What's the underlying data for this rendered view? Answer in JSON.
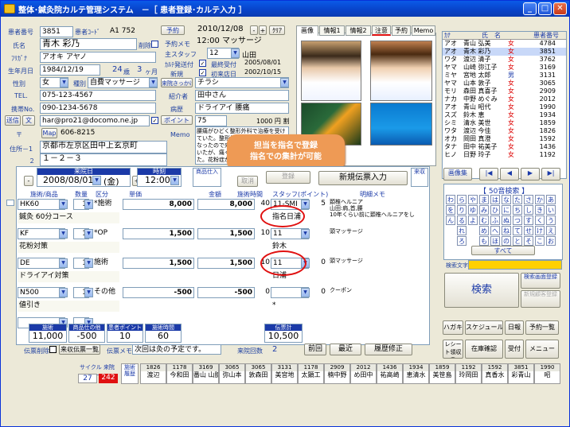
{
  "window": {
    "title": "整体･鍼灸院カルテ管理システム　－［ 患者登録･カルテ入力 ］"
  },
  "patient": {
    "no_label": "患者番号",
    "no": "3851",
    "code_label": "患者ｺｰﾄﾞ",
    "code": "A1 752",
    "name_label": "氏名",
    "name": "青木 彩乃",
    "delete_label": "削除",
    "furigana_label": "ﾌﾘｶﾞﾅ",
    "furigana": "アオキ アヤノ",
    "birth_label": "生年月日",
    "birth": "1984/12/19",
    "age": "24",
    "age_unit": "歳",
    "months": "3",
    "months_unit": "ヶ月",
    "sex_label": "性別",
    "sex": "女",
    "type_label": "種別",
    "type": "自費マッサージ",
    "tel_label": "TEL.",
    "tel": "075-123-4567",
    "mobile_label": "携帯No.",
    "mobile": "090-1234-5678",
    "email_btn": "送信",
    "email_btn2": "文",
    "email": "har@pro21@docomo.ne.jp",
    "zip_label": "〒",
    "map_btn": "Map",
    "zip": "606-8215",
    "addr1_label": "住所－1",
    "addr1": "京都市左京区田中上玄京町",
    "addr2_label": "２",
    "addr2": "１－２－３"
  },
  "reserve": {
    "label": "予約",
    "date": "2010/12/08",
    "minus": "-",
    "plus": "+",
    "clear": "ｸﾘｱ",
    "memo_label": "予約メモ",
    "memo": "12:00 マッサージ",
    "staff_label": "主スタッフ",
    "staff_no": "12",
    "staff_name": "山田",
    "last_label": "ｶﾙﾃ発送付",
    "last_check": "最終受付",
    "last_date": "2005/08/01",
    "new_label": "新規",
    "first_check": "初来店日",
    "first_date": "2002/10/15",
    "source_btn": "来院きっかけ",
    "source": "チラシ",
    "intro_label": "紹介者",
    "intro": "田中さん",
    "disease_label": "病歴",
    "disease": "ドライアイ 腰痛",
    "point_btn": "ポイント",
    "point": "75",
    "point_extra": "1000 円 割",
    "memo2_label": "Memo",
    "memo2": "腰痛がひどく整形外科で治療を受けていた。整形外科での治療より楽になったので来院された。牽引もしていたが、痛くなって嫌がってやめた。花粉症がひどいので、毎年春は大変。"
  },
  "tabs": {
    "items": [
      "画像",
      "情報1",
      "情報2",
      "注意",
      "予約",
      "Memo"
    ]
  },
  "tooltip": {
    "line1": "担当を指名で登録",
    "line2": "指名での集計が可能"
  },
  "visit": {
    "date_label": "来院日",
    "date": "2008/08/01",
    "weekday": "(金)",
    "minus": "-",
    "plus": "+",
    "time_label": "時刻",
    "time": "12:00",
    "product_label": "商品仕入",
    "cancel": "取消",
    "register": "登録",
    "new_slip": "新規伝票入力",
    "receipt_label": "来収"
  },
  "table": {
    "headers": [
      "施術/商品",
      "数量",
      "区分",
      "単価",
      "金額",
      "施術時間",
      "スタッフ(ポイント)",
      "明細メモ"
    ],
    "rows": [
      {
        "code": "HK60",
        "qty": "1",
        "cat": "*施術",
        "price": "8,000",
        "amount": "8,000",
        "time": "40",
        "staff": "11-SMI",
        "pts": "5",
        "memo": "頚椎ヘルニア\n山田:肩,首,腰\n10年くらい前に頚椎ヘルニアをし",
        "sub": "鍼灸 60分コース",
        "staff_sub": "指名日浦"
      },
      {
        "code": "KF",
        "qty": "1",
        "cat": "*OP",
        "price": "1,500",
        "amount": "1,500",
        "time": "10",
        "staff": "11",
        "pts": "",
        "memo": "頭マッサージ",
        "sub": "花粉対策",
        "staff_sub": "鈴木"
      },
      {
        "code": "DE",
        "qty": "1",
        "cat": "施術",
        "price": "1,500",
        "amount": "1,500",
        "time": "10",
        "staff": "11",
        "pts": "0",
        "memo": "頭マッサージ",
        "sub": "ドライアイ対策",
        "staff_sub": "日浦"
      },
      {
        "code": "N500",
        "qty": "1",
        "cat": "その他",
        "price": "-500",
        "amount": "-500",
        "time": "0",
        "staff": "",
        "pts": "0",
        "memo": "クーポン",
        "sub": "値引き",
        "staff_sub": "*"
      }
    ]
  },
  "totals": {
    "treat_label": "施術",
    "treat": "11,000",
    "goods_label": "商品仕の他",
    "goods": "-500",
    "point_label": "患者ポイント",
    "point": "10",
    "time_label": "施術時間",
    "time": "60",
    "slip_label": "伝票計",
    "slip": "10,500",
    "slip_delete": "伝票削除",
    "list_btn": "来収伝票一覧",
    "memo_label": "伝票メモ",
    "memo": "次回は灸の予定です。",
    "visits_label": "来院回数",
    "visits": "2",
    "prev": "前回",
    "latest": "最近",
    "history": "履歴修正"
  },
  "namelist": {
    "headers": [
      "ｶﾅ",
      "氏　名",
      "患者番号"
    ],
    "rows": [
      [
        "アオ",
        "青山 弘美",
        "女",
        "4784"
      ],
      [
        "アオ",
        "青木 彩乃",
        "女",
        "3851"
      ],
      [
        "ワタ",
        "渡辺 清子",
        "女",
        "3762"
      ],
      [
        "ヤマ",
        "山崎 弥江子",
        "女",
        "3169"
      ],
      [
        "ミヤ",
        "宮地 太郎",
        "男",
        "3131"
      ],
      [
        "ヤマ",
        "山本 敦子",
        "女",
        "3065"
      ],
      [
        "モリ",
        "森田 真喜子",
        "女",
        "2909"
      ],
      [
        "ナカ",
        "中野 めぐみ",
        "女",
        "2012"
      ],
      [
        "アオ",
        "青山 昭代",
        "女",
        "1990"
      ],
      [
        "スズ",
        "鈴木 恵",
        "女",
        "1934"
      ],
      [
        "シミ",
        "清水 美世",
        "女",
        "1859"
      ],
      [
        "ワタ",
        "渡辺 今佳",
        "女",
        "1826"
      ],
      [
        "オカ",
        "岡田 真澄",
        "女",
        "1592"
      ],
      [
        "タナ",
        "田中 祐美子",
        "女",
        "1436"
      ],
      [
        "ヒノ",
        "日野 玲子",
        "女",
        "1192"
      ]
    ]
  },
  "right": {
    "image_btn": "画像集",
    "kana_title": "【 50音検索 】",
    "kana": [
      [
        "わ",
        "ら",
        "や",
        "ま",
        "は",
        "な",
        "た",
        "さ",
        "か",
        "あ"
      ],
      [
        "を",
        "り",
        "ゆ",
        "み",
        "ひ",
        "に",
        "ち",
        "し",
        "き",
        "い"
      ],
      [
        "ん",
        "る",
        "よ",
        "む",
        "ふ",
        "ぬ",
        "つ",
        "す",
        "く",
        "う"
      ],
      [
        "",
        "れ",
        "",
        "め",
        "へ",
        "ね",
        "て",
        "せ",
        "け",
        "え"
      ],
      [
        "",
        "ろ",
        "",
        "も",
        "ほ",
        "の",
        "と",
        "そ",
        "こ",
        "お"
      ]
    ],
    "all": "すべて",
    "search_label": "検索文字",
    "search": "検索",
    "cond_btn": "検索画面登録",
    "new_btn": "新規顧客登録",
    "btns": [
      "ハガキ",
      "スケジュール",
      "日報",
      "予約一覧",
      "レシート領収書",
      "在庫確認",
      "受付",
      "メニュー"
    ]
  },
  "bottom": {
    "cycle_label": "サイクル",
    "cycle": "27",
    "visits_label": "来院一",
    "visits": "242",
    "shift_label": "施術履歴",
    "cols": [
      [
        "1826",
        "渡辺"
      ],
      [
        "1178",
        "今和田"
      ],
      [
        "3169",
        "番山 山膝"
      ],
      [
        "3065",
        "弥山本"
      ],
      [
        "3065",
        "敦森田"
      ],
      [
        "3131",
        "美宮地"
      ],
      [
        "1178",
        "太顕工"
      ],
      [
        "2909",
        "楠中野"
      ],
      [
        "2012",
        "め田中"
      ],
      [
        "1436",
        "祐高崎"
      ],
      [
        "1934",
        "恵清水"
      ],
      [
        "1859",
        "美笹島"
      ],
      [
        "1192",
        "玲岡田"
      ],
      [
        "1592",
        "真香水"
      ],
      [
        "3851",
        "彩青山"
      ],
      [
        "1990",
        "昭"
      ]
    ]
  }
}
